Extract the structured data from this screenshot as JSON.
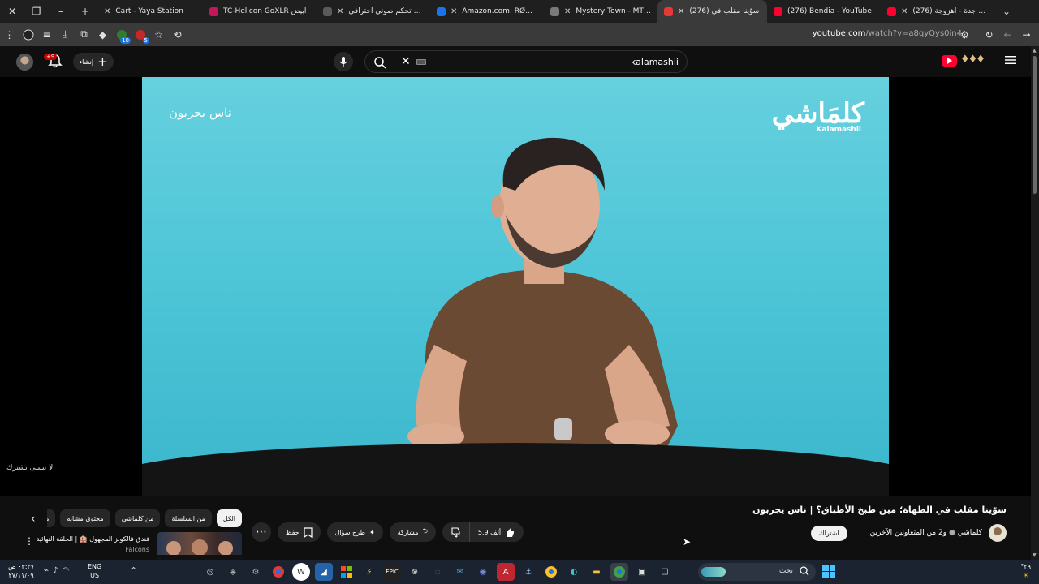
{
  "tabs": [
    {
      "title": "Cart - Yaya Station",
      "favicon_color": "#1f1f1f",
      "active": false
    },
    {
      "title": "TC-Helicon GoXLR أبيض",
      "favicon_color": "#c2185b",
      "active": false
    },
    {
      "title": "جهاز تحكم صوتي احترافي",
      "favicon_color": "#5a5a5a",
      "active": false
    },
    {
      "title": "Amazon.com: RØDE Podi",
      "favicon_color": "#1a73e8",
      "active": false
    },
    {
      "title": "Mystery Town - MT Studi",
      "favicon_color": "#7a7a7a",
      "active": false
    },
    {
      "title": "(276) سوّينا مقلب في",
      "favicon_color": "#e53935",
      "active": true
    },
    {
      "title": "(276) Bendia - YouTube",
      "favicon_color": "#ff0033",
      "active": false
    },
    {
      "title": "(276) ايقونة جدة - اهزوجة",
      "favicon_color": "#ff0033",
      "active": false
    }
  ],
  "toolbar": {
    "url_host": "youtube.com",
    "url_path": "/watch?v=a8qyQys0in4",
    "extension_badges": [
      "10",
      "5"
    ]
  },
  "masthead": {
    "notification_count": "+9",
    "create_label": "إنشاء",
    "search_value": "kalamashii"
  },
  "video": {
    "overlay_tag": "ناس يجربون",
    "brand_arabic": "كلمَاشي",
    "brand_english": "Kalamashii",
    "watch_later_hint": "لا تنسى تشترك"
  },
  "details": {
    "title": "سوّينا مقلب في الطهاة؛ مين طبخ الأطباق؟ | ناس يجربون",
    "channel": "كلماشي",
    "collab_suffix": "و2 من المتعاونين الآخرين",
    "subscribe_label": "اشتراك",
    "likes": "5.9 ألف",
    "share_label": "مشاركة",
    "ask_label": "طرح سؤال",
    "save_label": "حفظ"
  },
  "chips": [
    "الكل",
    "من السلسلة",
    "من كلماشي",
    "محتوى مشابه",
    "محتوى"
  ],
  "recommendation": {
    "title": "فندق فالكونز المجهول 🏨 | الحلقة النهائية",
    "channel": "Falcons"
  },
  "taskbar": {
    "time": "٠٣:٣٧ ص",
    "date": "٢٧/١١/٠٩",
    "lang_top": "ENG",
    "lang_bottom": "US",
    "search_placeholder": "بحث",
    "weather_temp": "°٢٩"
  },
  "colors": {
    "youtube_red": "#ff0033",
    "video_background": "#4fc6d8",
    "accent_blue": "#4cc2ff"
  }
}
